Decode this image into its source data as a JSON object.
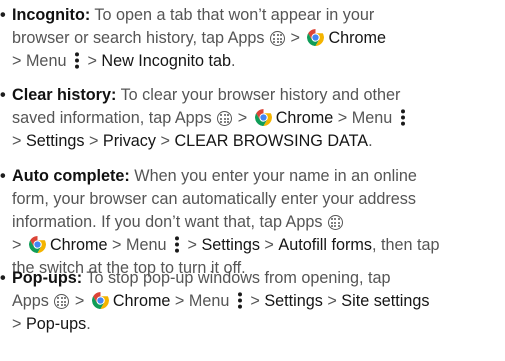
{
  "items": [
    {
      "term": "Incognito:",
      "lines": [
        [
          {
            "t": "text",
            "v": " To open a tab that won’t appear in your"
          }
        ],
        [
          {
            "t": "text",
            "v": "browser or search history, tap Apps "
          },
          {
            "t": "icon",
            "v": "apps-icon"
          },
          {
            "t": "text",
            "v": " > "
          },
          {
            "t": "icon",
            "v": "chrome-icon"
          },
          {
            "t": "b",
            "v": "Chrome"
          }
        ],
        [
          {
            "t": "text",
            "v": "> Menu "
          },
          {
            "t": "icon",
            "v": "menu-icon"
          },
          {
            "t": "text",
            "v": " > "
          },
          {
            "t": "b",
            "v": "New Incognito tab"
          },
          {
            "t": "text",
            "v": "."
          }
        ]
      ]
    },
    {
      "term": "Clear history:",
      "lines": [
        [
          {
            "t": "text",
            "v": " To clear your browser history and other"
          }
        ],
        [
          {
            "t": "text",
            "v": "saved information, tap Apps "
          },
          {
            "t": "icon",
            "v": "apps-icon"
          },
          {
            "t": "text",
            "v": " > "
          },
          {
            "t": "icon",
            "v": "chrome-icon"
          },
          {
            "t": "b",
            "v": "Chrome"
          },
          {
            "t": "text",
            "v": " > Menu "
          },
          {
            "t": "icon",
            "v": "menu-icon"
          }
        ],
        [
          {
            "t": "text",
            "v": "> "
          },
          {
            "t": "b",
            "v": "Settings"
          },
          {
            "t": "text",
            "v": " > "
          },
          {
            "t": "b",
            "v": "Privacy"
          },
          {
            "t": "text",
            "v": " > "
          },
          {
            "t": "b",
            "v": "CLEAR BROWSING DATA"
          },
          {
            "t": "text",
            "v": "."
          }
        ]
      ]
    },
    {
      "term": "Auto complete:",
      "lines": [
        [
          {
            "t": "text",
            "v": " When you enter your name in an online"
          }
        ],
        [
          {
            "t": "text",
            "v": "form, your browser can automatically enter your address"
          }
        ],
        [
          {
            "t": "text",
            "v": "information. If you don’t want that, tap Apps "
          },
          {
            "t": "icon",
            "v": "apps-icon"
          }
        ],
        [
          {
            "t": "text",
            "v": "> "
          },
          {
            "t": "icon",
            "v": "chrome-icon"
          },
          {
            "t": "b",
            "v": "Chrome"
          },
          {
            "t": "text",
            "v": " > Menu "
          },
          {
            "t": "icon",
            "v": "menu-icon"
          },
          {
            "t": "text",
            "v": " > "
          },
          {
            "t": "b",
            "v": "Settings"
          },
          {
            "t": "text",
            "v": " > "
          },
          {
            "t": "b",
            "v": "Autofill forms"
          },
          {
            "t": "text",
            "v": ", then tap"
          }
        ],
        [
          {
            "t": "text",
            "v": "the switch at the top to turn it off."
          }
        ]
      ]
    },
    {
      "term": "Pop-ups:",
      "lines": [
        [
          {
            "t": "text",
            "v": " To stop pop-up windows from opening, tap"
          }
        ],
        [
          {
            "t": "text",
            "v": "Apps "
          },
          {
            "t": "icon",
            "v": "apps-icon"
          },
          {
            "t": "text",
            "v": " > "
          },
          {
            "t": "icon",
            "v": "chrome-icon"
          },
          {
            "t": "b",
            "v": "Chrome"
          },
          {
            "t": "text",
            "v": " > Menu "
          },
          {
            "t": "icon",
            "v": "menu-icon"
          },
          {
            "t": "text",
            "v": " > "
          },
          {
            "t": "b",
            "v": "Settings"
          },
          {
            "t": "text",
            "v": " > "
          },
          {
            "t": "b",
            "v": "Site settings"
          }
        ],
        [
          {
            "t": "text",
            "v": "> "
          },
          {
            "t": "b",
            "v": "Pop-ups"
          },
          {
            "t": "text",
            "v": "."
          }
        ]
      ]
    }
  ],
  "colors": {
    "text": "#555555",
    "bold": "#151515",
    "chrome_red": "#db4437",
    "chrome_yellow": "#f4b400",
    "chrome_green": "#0f9d58",
    "chrome_blue": "#4285f4"
  }
}
